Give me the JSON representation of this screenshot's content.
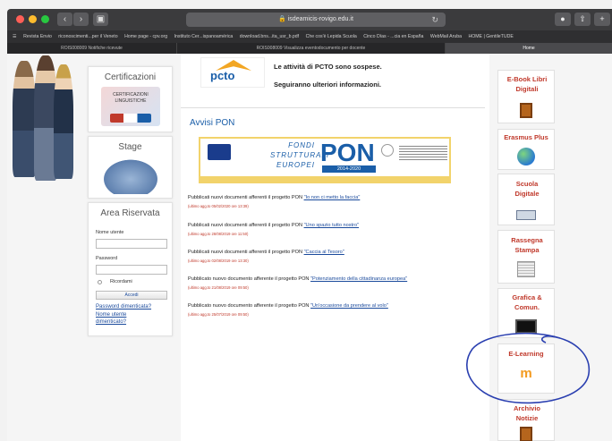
{
  "browser": {
    "url": "isdeamicis-rovigo.edu.it",
    "bookmarks": [
      "Revista Envio",
      "riconoscimenti...per il Veneto",
      "Home page - cpv.org",
      "Instituto Cer...ispanoamérica",
      "download.bns...ita_usr_b.pdf",
      "Che cos'è Lepida Scuola",
      "Cinco Días - ...cia en España",
      "WebMail Aruba",
      "HOME | GentileTUDE"
    ],
    "tabs": [
      "ROIS008009 Notifiche ricevute",
      "ROIS008009 Visualizza eventodocumento per docente",
      "Home"
    ]
  },
  "left": {
    "certificazioni_title": "Certificazioni",
    "cert_image_text": "CERTIFICAZIONI LINGUISTICHE",
    "stage_title": "Stage",
    "area_title": "Area Riservata",
    "username_label": "Nome utente",
    "password_label": "Password",
    "remember_label": "Ricordami",
    "login_button": "Accedi",
    "forgot_password": "Password dimenticata?",
    "forgot_username": "Nome utente dimenticato?"
  },
  "main": {
    "pcto_logo": "pcto",
    "pcto_line1": "Le attività di PCTO sono sospese.",
    "pcto_line2": "Seguiranno ulteriori informazioni.",
    "pon_heading": "Avvisi PON",
    "pon_banner": {
      "fondi": "FONDI",
      "strutturali": "STRUTTURALI",
      "europei": "EUROPEI",
      "pon": "PON",
      "years": "2014-2020"
    },
    "news": [
      {
        "text": "Pubblicati nuovi documenti afferenti il progetto PON ",
        "link": "\"Io non ci metto la faccia\"",
        "date": "(ultimo agg.to 05/02/2020 ore 13:39)"
      },
      {
        "text": "Pubblicati nuovi documenti afferenti il progetto PON ",
        "link": "\"Uno spazio tutto nostro\"",
        "date": "(ultimo agg.to 28/08/2019 ore 11:50)"
      },
      {
        "text": "Pubblicati nuovi documenti afferenti il progetto PON ",
        "link": "\"Caccia al Tesoro\"",
        "date": "(ultimo agg.to 02/08/2019 ore 13:30)"
      },
      {
        "text": "Pubblicato nuovo documento afferente il progetto PON ",
        "link": "\"Potenziamento della cittadinanza europea\"",
        "date": "(ultimo agg.to 21/08/2019 ore 09:50)"
      },
      {
        "text": "Pubblicato nuovo documento afferente il progetto PON ",
        "link": "\"Un'occasione da prendere al volo\"",
        "date": "(ultimo agg.to 25/07/2019 ore 09:50)"
      }
    ]
  },
  "right": {
    "items": [
      {
        "label": "E-Book Libri Digitali",
        "icon": "book-icon"
      },
      {
        "label": "Erasmus Plus",
        "icon": "globe-icon"
      },
      {
        "label": "Scuola Digitale",
        "icon": "projector-icon"
      },
      {
        "label": "Rassegna Stampa",
        "icon": "newspaper-icon"
      },
      {
        "label": "Grafica & Comun.",
        "icon": "monitor-icon"
      },
      {
        "label": "E-Learning",
        "icon": "moodle-icon"
      },
      {
        "label": "Archivio Notizie",
        "icon": "archive-icon"
      }
    ]
  },
  "colors": {
    "accent_red": "#c0392b",
    "link_blue": "#1a4a9c",
    "pon_blue": "#1a5ea8"
  }
}
